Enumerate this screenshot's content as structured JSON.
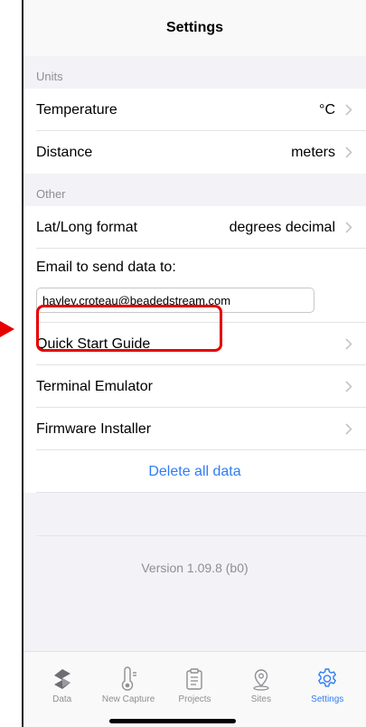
{
  "nav": {
    "title": "Settings"
  },
  "units": {
    "header": "Units",
    "temperature": {
      "label": "Temperature",
      "value": "°C"
    },
    "distance": {
      "label": "Distance",
      "value": "meters"
    }
  },
  "other": {
    "header": "Other",
    "latlong": {
      "label": "Lat/Long format",
      "value": "degrees decimal"
    },
    "email_label": "Email to send data to:",
    "email_value": "hayley.croteau@beadedstream.com",
    "quick_start": "Quick Start Guide",
    "terminal": "Terminal Emulator",
    "firmware": "Firmware Installer",
    "delete_all": "Delete all data"
  },
  "version": "Version 1.09.8 (b0)",
  "tabs": [
    {
      "label": "Data",
      "icon": "data-logo-icon",
      "active": false
    },
    {
      "label": "New Capture",
      "icon": "thermometer-icon",
      "active": false
    },
    {
      "label": "Projects",
      "icon": "clipboard-icon",
      "active": false
    },
    {
      "label": "Sites",
      "icon": "location-pin-icon",
      "active": false
    },
    {
      "label": "Settings",
      "icon": "gear-icon",
      "active": true
    }
  ],
  "colors": {
    "accent": "#2f7cf6",
    "highlight": "#e60000",
    "secondary_text": "#8e8e93"
  }
}
